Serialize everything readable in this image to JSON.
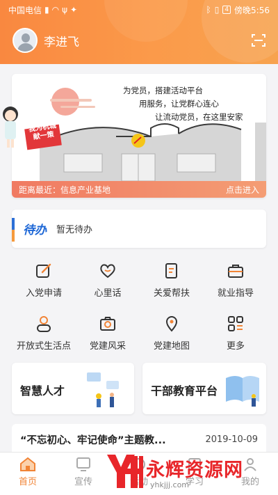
{
  "status_bar": {
    "carrier": "中国电信",
    "battery": "4",
    "time": "傍晚5:56"
  },
  "header": {
    "user_name": "李进飞",
    "accent_color": "#f98840"
  },
  "banner": {
    "slogan_lines": [
      "为党员，搭建活动平台",
      "用服务，让党群心连心",
      "让流动党员，在这里安家"
    ],
    "sign_text": [
      "我为杭城",
      "献一策"
    ],
    "distance_text": "距离最近：信息产业基地",
    "enter_text": "点击进入"
  },
  "todo": {
    "tag": "待办",
    "text": "暂无待办"
  },
  "grid": {
    "items": [
      {
        "label": "入党申请",
        "icon": "edit-icon"
      },
      {
        "label": "心里话",
        "icon": "heart-icon"
      },
      {
        "label": "关爱帮扶",
        "icon": "document-icon"
      },
      {
        "label": "就业指导",
        "icon": "briefcase-icon"
      },
      {
        "label": "开放式生活点",
        "icon": "person-icon"
      },
      {
        "label": "党建风采",
        "icon": "camera-icon"
      },
      {
        "label": "党建地图",
        "icon": "map-pin-icon"
      },
      {
        "label": "更多",
        "icon": "more-icon"
      }
    ]
  },
  "cards": {
    "talent": "智慧人才",
    "education": "干部教育平台"
  },
  "news": {
    "title": "“不忘初心、牢记使命”主题教...",
    "date": "2019-10-09"
  },
  "tabbar": {
    "items": [
      {
        "label": "首页"
      },
      {
        "label": "宣传"
      },
      {
        "label": "活动"
      },
      {
        "label": "学习"
      },
      {
        "label": "我的"
      }
    ],
    "active_color": "#f18436"
  },
  "watermark": {
    "text": "永辉资源网",
    "url": "yhkjjj.com"
  }
}
